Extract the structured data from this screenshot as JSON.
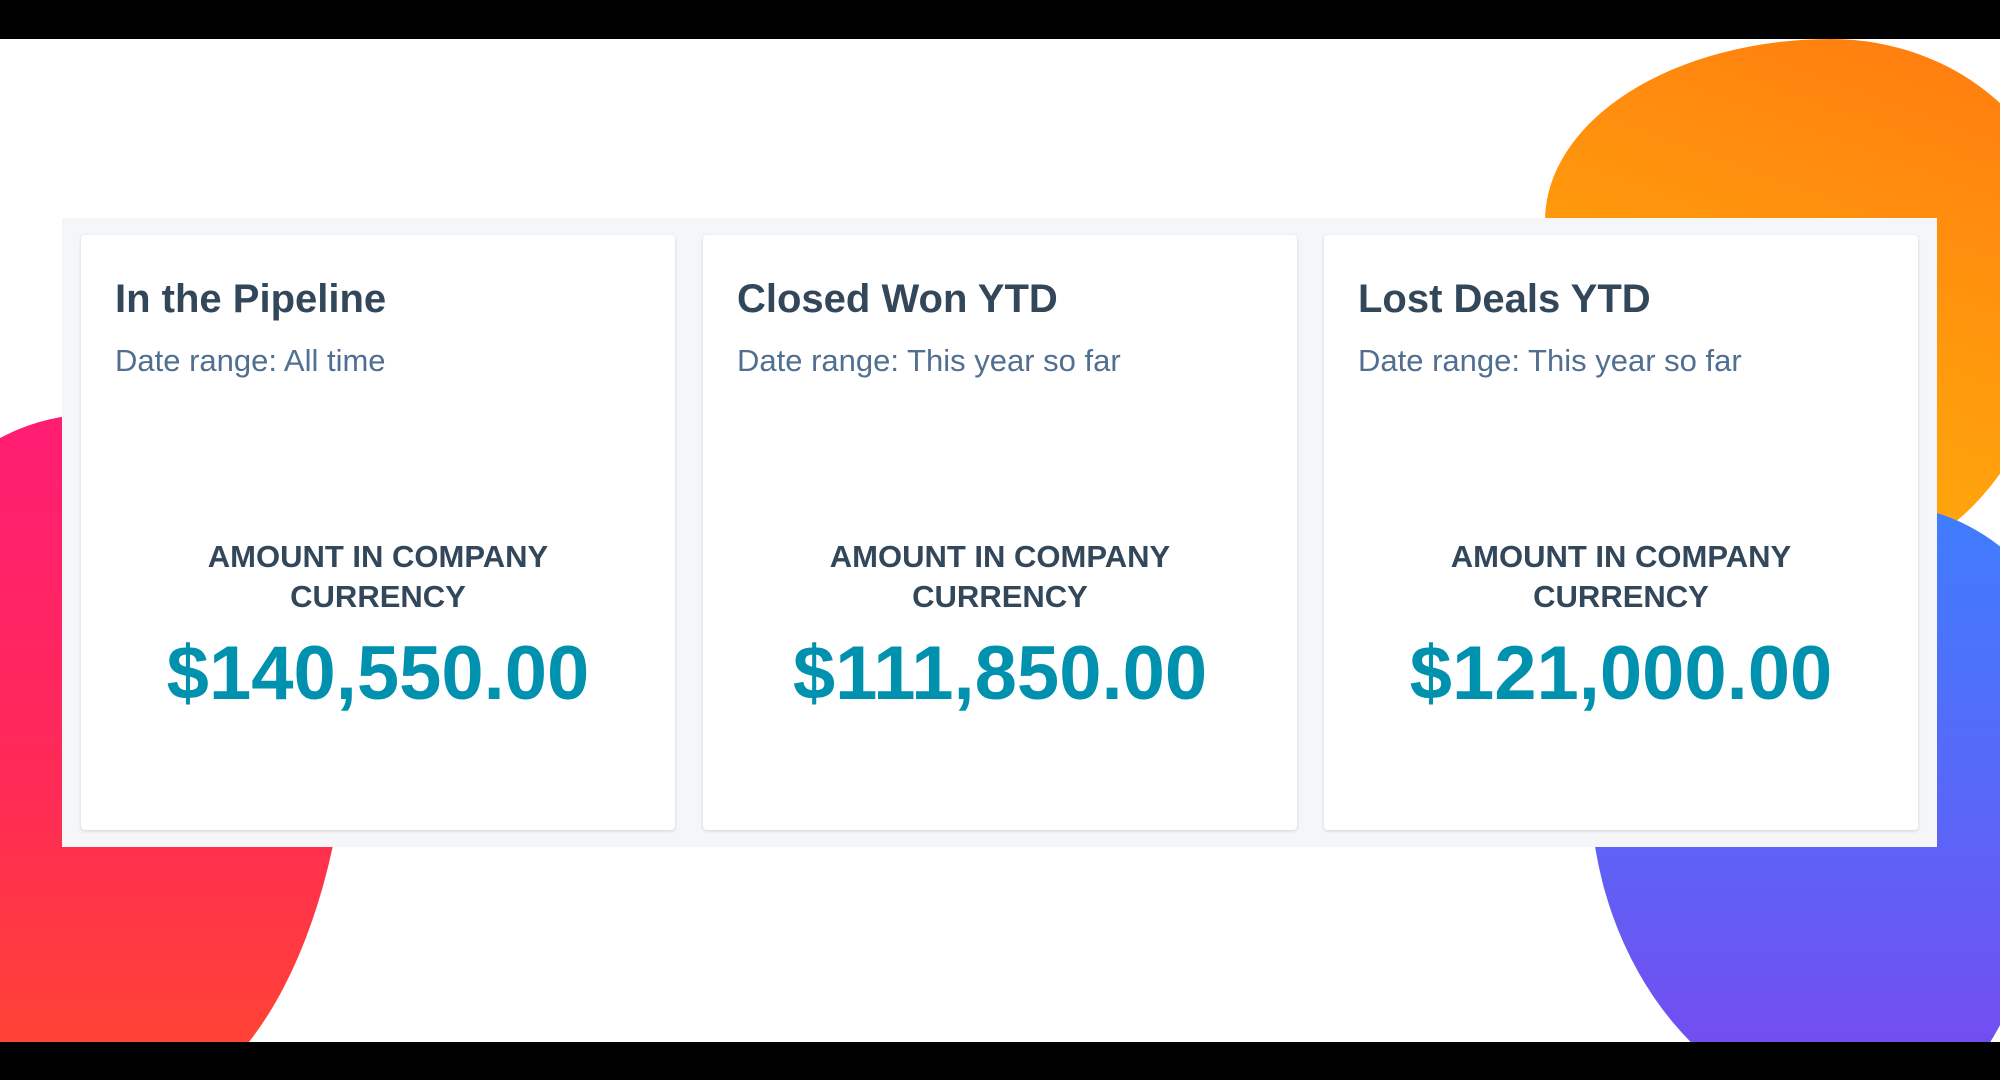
{
  "theme": {
    "background": "#ffffff",
    "frame": "#000000",
    "panel_background": "#f4f6f8",
    "card_background": "#ffffff",
    "title_color": "#33475b",
    "subtitle_color": "#516f90",
    "value_color": "#0091ae",
    "decor_left_colors": [
      "#ff1d73",
      "#ff4a2a"
    ],
    "decor_right_top_colors": [
      "#ff7a10",
      "#ffb00c"
    ],
    "decor_right_bottom_colors": [
      "#3f7dff",
      "#7b45ef"
    ]
  },
  "dashboard": {
    "cards": [
      {
        "title": "In the Pipeline",
        "date_range": "Date range:  All time",
        "metric_label": "AMOUNT IN COMPANY CURRENCY",
        "metric_value": "$140,550.00"
      },
      {
        "title": "Closed Won YTD",
        "date_range": "Date range:  This year so far",
        "metric_label": "AMOUNT IN COMPANY CURRENCY",
        "metric_value": "$111,850.00"
      },
      {
        "title": "Lost Deals YTD",
        "date_range": "Date range:  This year so far",
        "metric_label": "AMOUNT IN COMPANY CURRENCY",
        "metric_value": "$121,000.00"
      }
    ]
  }
}
